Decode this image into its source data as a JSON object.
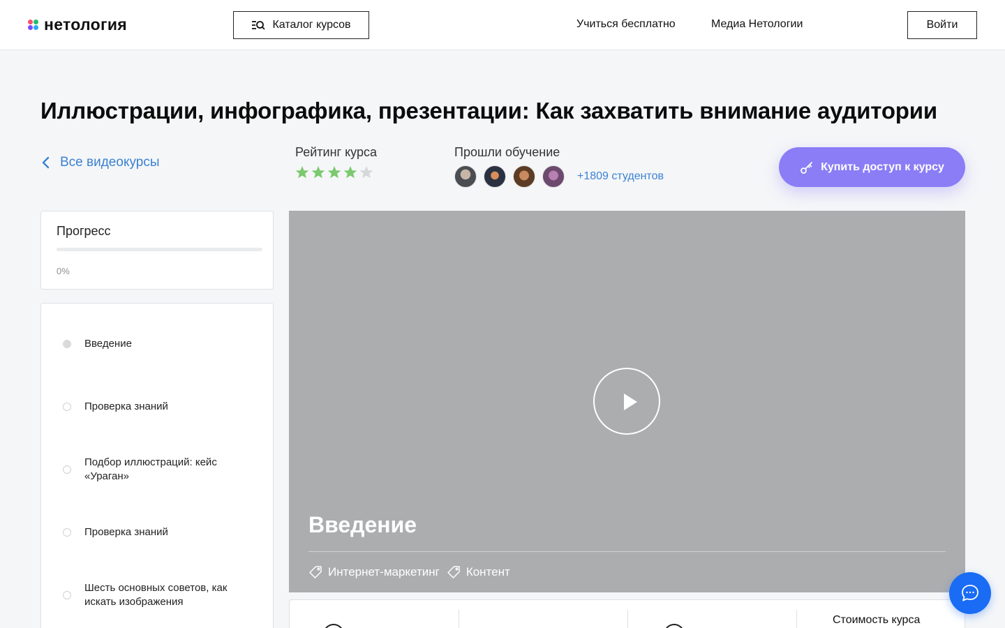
{
  "header": {
    "logo_text": "нетология",
    "catalog_label": "Каталог курсов",
    "nav": [
      "Учиться бесплатно",
      "Медиа Нетологии"
    ],
    "login_label": "Войти"
  },
  "course": {
    "title": "Иллюстрации, инфографика, презентации: Как захватить внимание аудитории",
    "back_label": "Все видеокурсы",
    "rating_label": "Рейтинг курса",
    "rating_value": 4,
    "rating_max": 5,
    "passed_label": "Прошли обучение",
    "students_label": "+1809 студентов",
    "buy_label": "Купить доступ к курсу"
  },
  "progress": {
    "title": "Прогресс",
    "percent_label": "0%",
    "value": 0
  },
  "lessons": [
    {
      "label": "Введение",
      "active": true
    },
    {
      "label": "Проверка знаний",
      "active": false
    },
    {
      "label": "Подбор иллюстраций: кейс «Ураган»",
      "active": false
    },
    {
      "label": "Проверка знаний",
      "active": false
    },
    {
      "label": "Шесть основных советов, как искать изображения",
      "active": false
    }
  ],
  "video": {
    "title": "Введение",
    "tags": [
      "Интернет-маркетинг",
      "Контент"
    ]
  },
  "info_bar": {
    "cost_label": "Стоимость курса"
  },
  "colors": {
    "accent": "#8a7df6",
    "link": "#3b82d1",
    "star_filled": "#7bc96f",
    "star_empty": "#d6d7d9",
    "chat": "#1a6cf5"
  }
}
